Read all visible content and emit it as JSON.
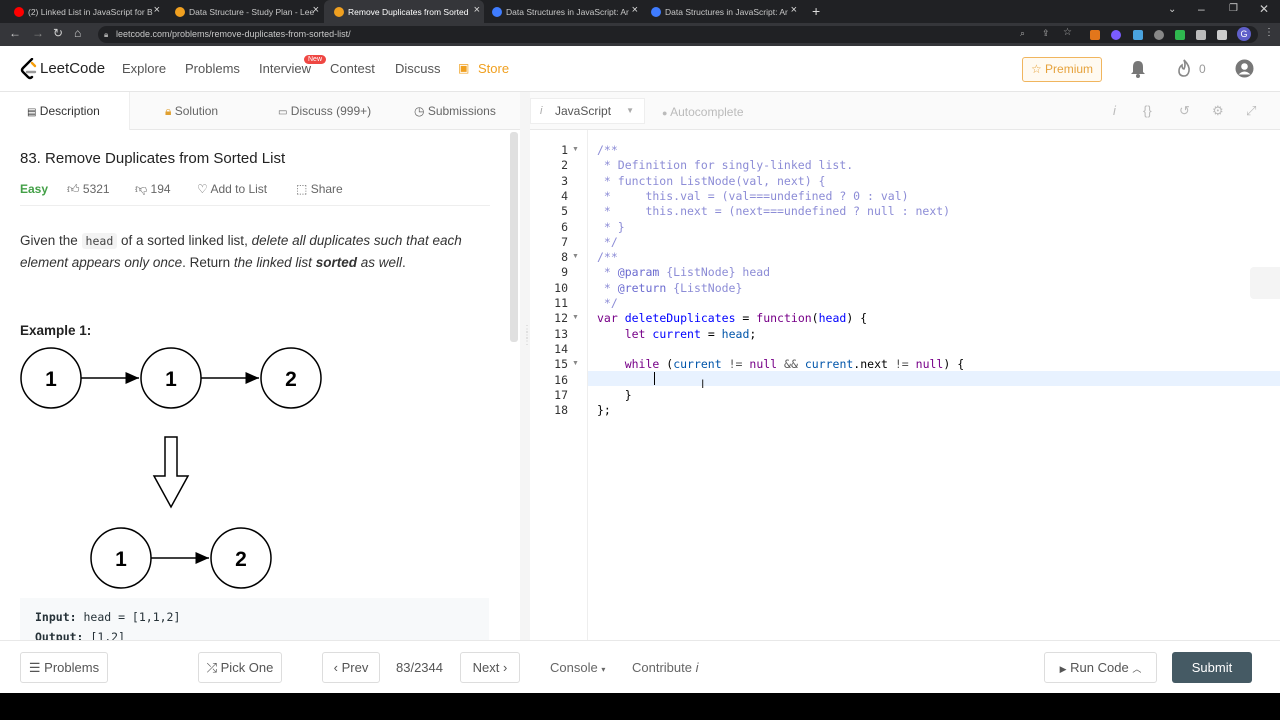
{
  "browser": {
    "tabs": [
      {
        "title": "(2) Linked List in JavaScript for B",
        "favicon_color": "#ff0000",
        "active": false
      },
      {
        "title": "Data Structure - Study Plan - Lee",
        "favicon_color": "#f0a020",
        "active": false
      },
      {
        "title": "Remove Duplicates from Sorted",
        "favicon_color": "#f0a020",
        "active": true
      },
      {
        "title": "Data Structures in JavaScript: Ar",
        "favicon_color": "#3f7cff",
        "active": false
      },
      {
        "title": "Data Structures in JavaScript: Ar",
        "favicon_color": "#3f7cff",
        "active": false
      }
    ],
    "url": "leetcode.com/problems/remove-duplicates-from-sorted-list/",
    "profile_initial": "G"
  },
  "header": {
    "logo_text": "LeetCode",
    "nav": [
      "Explore",
      "Problems",
      "Interview",
      "Contest",
      "Discuss"
    ],
    "new_badge": "New",
    "store": "Store",
    "premium": "Premium",
    "streak_count": "0"
  },
  "left_tabs": [
    "Description",
    "Solution",
    "Discuss (999+)",
    "Submissions"
  ],
  "problem": {
    "title": "83. Remove Duplicates from Sorted List",
    "difficulty": "Easy",
    "likes": "5321",
    "dislikes": "194",
    "add_to_list": "Add to List",
    "share": "Share",
    "desc_part1": "Given the ",
    "desc_code": "head",
    "desc_part2": " of a sorted linked list, ",
    "desc_italic1": "delete all duplicates such that each element appears only once",
    "desc_part3": ". Return ",
    "desc_italic2": "the linked list ",
    "desc_bold": "sorted",
    "desc_italic3": " as well",
    "desc_part4": ".",
    "example_title": "Example 1:",
    "diagram_top": [
      "1",
      "1",
      "2"
    ],
    "diagram_bottom": [
      "1",
      "2"
    ],
    "input_label": "Input:",
    "input_value": " head = [1,1,2]",
    "output_label": "Output:",
    "output_value": " [1,2]"
  },
  "editor": {
    "language": "JavaScript",
    "autocomplete": "Autocomplete",
    "line_numbers": [
      "1",
      "2",
      "3",
      "4",
      "5",
      "6",
      "7",
      "8",
      "9",
      "10",
      "11",
      "12",
      "13",
      "14",
      "15",
      "16",
      "17",
      "18"
    ]
  },
  "footer": {
    "problems": "Problems",
    "pick_one": "Pick One",
    "prev": "Prev",
    "page_counter": "83/2344",
    "next": "Next",
    "console": "Console",
    "contribute": "Contribute",
    "run_code": "Run Code",
    "submit": "Submit"
  }
}
